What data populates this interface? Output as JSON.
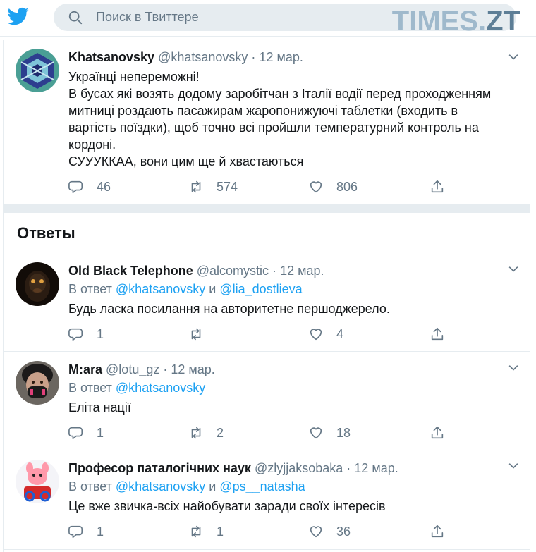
{
  "search": {
    "placeholder": "Поиск в Твиттере"
  },
  "watermark": {
    "part1": "TIMES.",
    "part2": "ZT"
  },
  "colors": {
    "accent": "#1da1f2",
    "muted": "#657786",
    "divider": "#e6ecf0"
  },
  "main_tweet": {
    "name": "Khatsanovsky",
    "handle": "@khatsanovsky",
    "date": "12 мар.",
    "lines": [
      "Українці непереможні!",
      "В бусах які возять додому заробітчан з Італії водії перед проходженням",
      "митниці роздають пасажирам жаропонижуючі таблетки (входить в",
      "вартість поїздки), щоб точно всі пройшли температурний контроль на",
      "кордоні.",
      "СУУУККАА, вони цим ще й хвастаються"
    ],
    "replies": "46",
    "retweets": "574",
    "likes": "806"
  },
  "replies_section": {
    "title": "Ответы"
  },
  "replies": [
    {
      "name": "Old Black Telephone",
      "handle": "@alcomystic",
      "date": "12 мар.",
      "reply_prefix": "В ответ",
      "mention1": "@khatsanovsky",
      "conj": "и",
      "mention2": "@lia_dostlieva",
      "text": "Будь ласка посилання на авторитетне першоджерело.",
      "replies": "1",
      "retweets": "",
      "likes": "4"
    },
    {
      "name": "M:ara",
      "handle": "@lotu_gz",
      "date": "12 мар.",
      "reply_prefix": "В ответ",
      "mention1": "@khatsanovsky",
      "text": "Еліта нації",
      "replies": "1",
      "retweets": "2",
      "likes": "18"
    },
    {
      "name": "Професор паталогічних наук",
      "handle": "@zlyjjaksobaka",
      "date": "12 мар.",
      "reply_prefix": "В ответ",
      "mention1": "@khatsanovsky",
      "conj": "и",
      "mention2": "@ps__natasha",
      "text": "Це вже звичка-всіх найобувати заради своїх інтересів",
      "replies": "1",
      "retweets": "1",
      "likes": "36"
    }
  ]
}
